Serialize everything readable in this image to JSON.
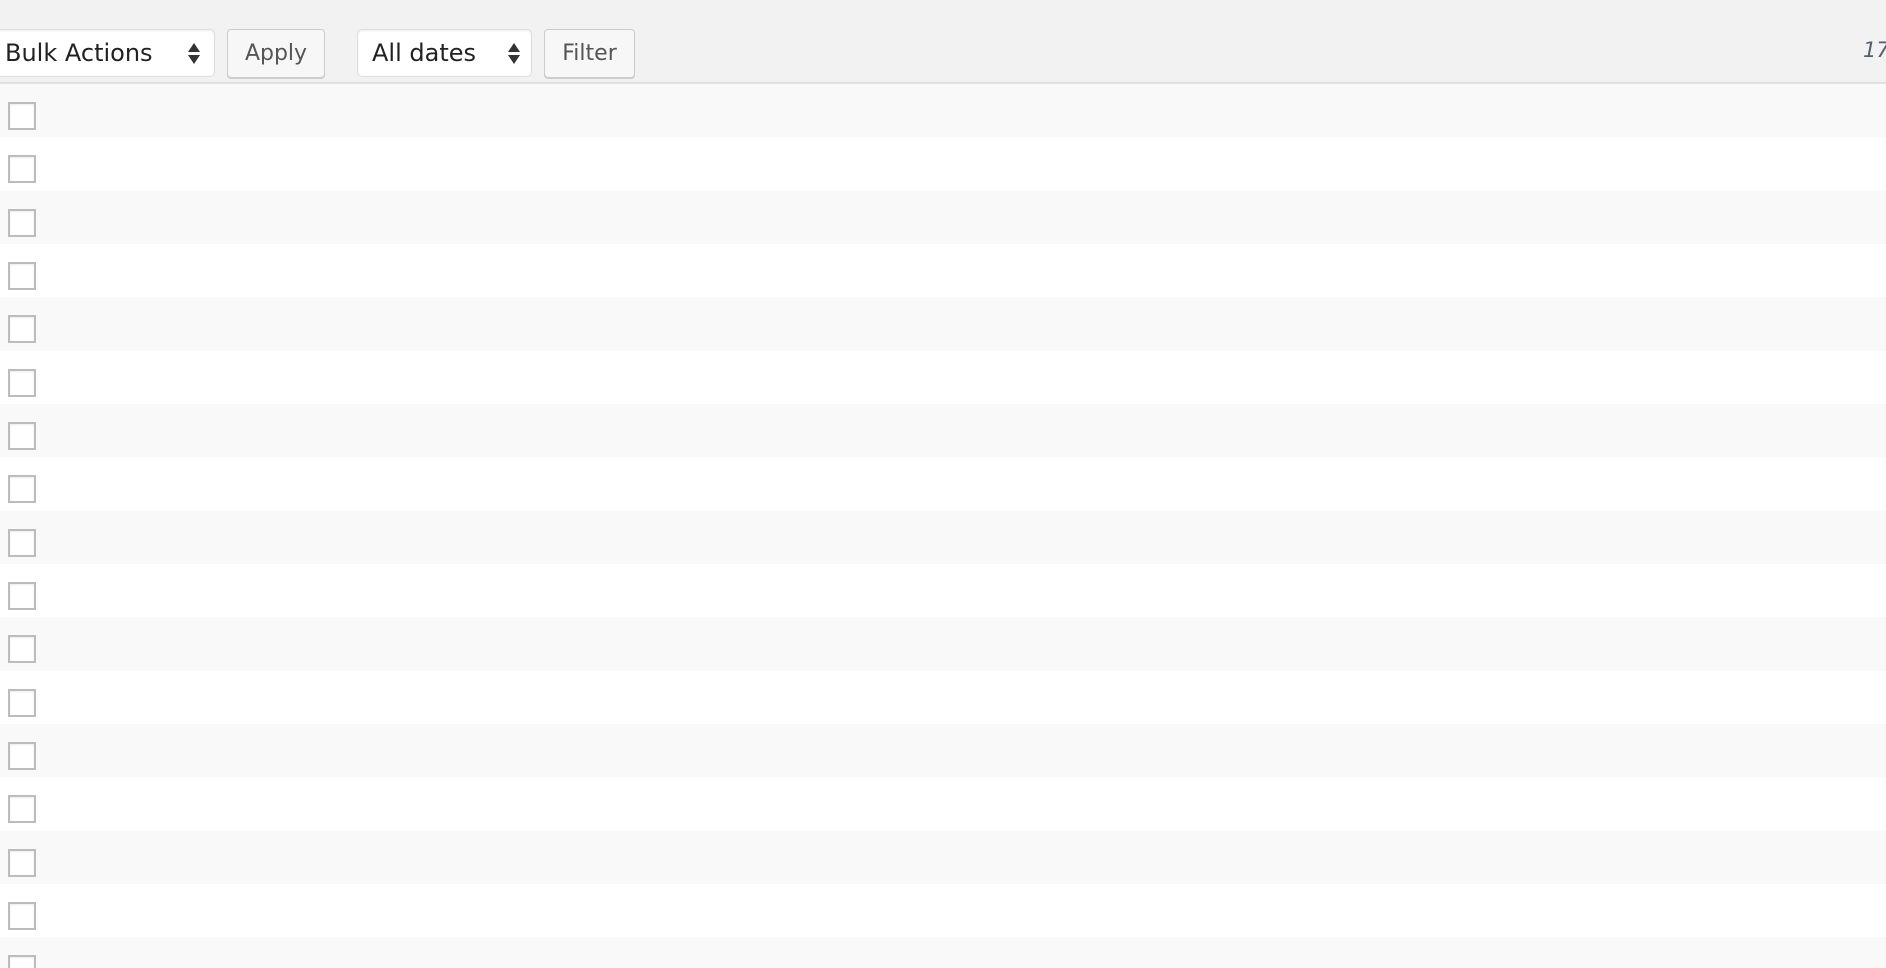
{
  "toolbar": {
    "bulk_actions": {
      "selected": "Bulk Actions",
      "icon": "select-arrows-icon"
    },
    "apply_label": "Apply",
    "date_filter": {
      "selected": "All dates",
      "icon": "select-arrows-icon"
    },
    "filter_label": "Filter",
    "item_count_text": "17"
  },
  "list": {
    "row_count_visible": 17,
    "rows": [
      {
        "checked": false
      },
      {
        "checked": false
      },
      {
        "checked": false
      },
      {
        "checked": false
      },
      {
        "checked": false
      },
      {
        "checked": false
      },
      {
        "checked": false
      },
      {
        "checked": false
      },
      {
        "checked": false
      },
      {
        "checked": false
      },
      {
        "checked": false
      },
      {
        "checked": false
      },
      {
        "checked": false
      },
      {
        "checked": false
      },
      {
        "checked": false
      },
      {
        "checked": false
      },
      {
        "checked": false
      }
    ]
  },
  "colors": {
    "toolbar_bg": "#f2f2f2",
    "row_alt_bg": "#f9f9f9",
    "row_bg": "#ffffff",
    "separator": "#e1e1e1",
    "checkbox_border": "#bcbcbc"
  }
}
